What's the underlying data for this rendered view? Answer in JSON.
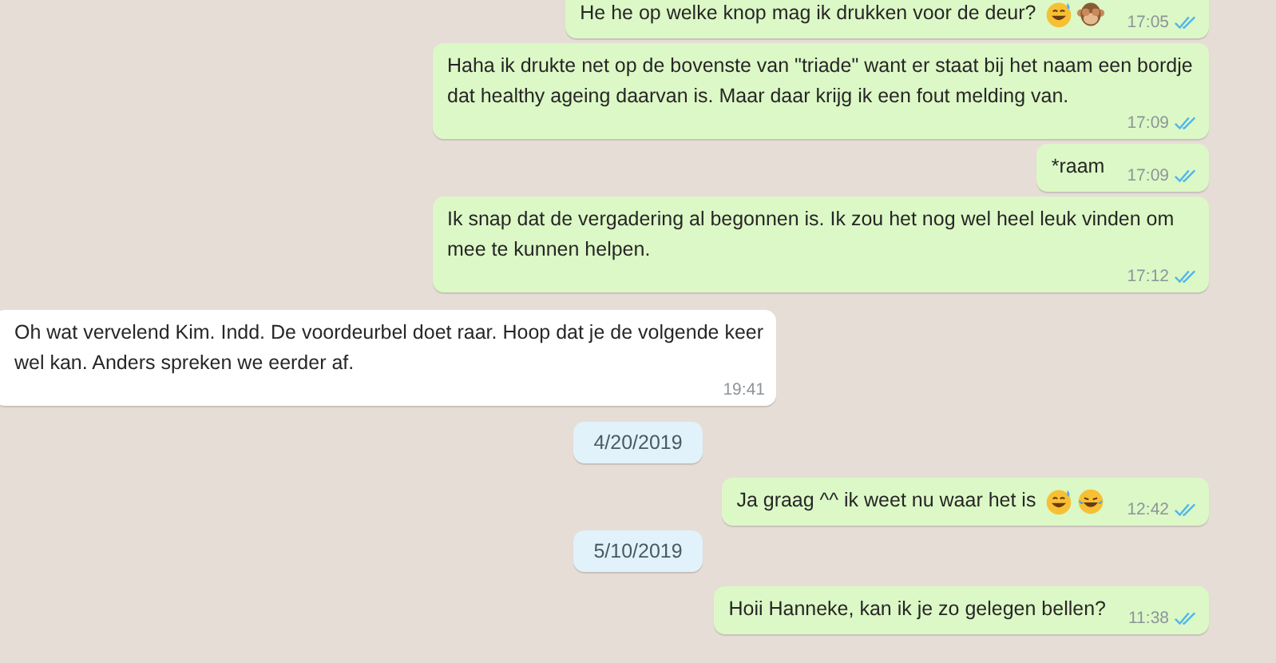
{
  "messages": [
    {
      "kind": "out",
      "text": "He he  op welke knop mag ik drukken voor de deur?",
      "emojis": [
        {
          "kind": "sweat-smile"
        },
        {
          "kind": "see-no-evil"
        }
      ],
      "time": "17:05",
      "read": true
    },
    {
      "kind": "out",
      "text": "Haha ik drukte net op de bovenste van \"triade\"  want er staat bij het naam een bordje dat healthy ageing daarvan is. Maar daar krijg ik een fout melding van.",
      "time": "17:09",
      "read": true
    },
    {
      "kind": "out",
      "text": "*raam",
      "time": "17:09",
      "read": true
    },
    {
      "kind": "out",
      "text": "Ik snap dat de vergadering al begonnen is. Ik zou het nog wel heel leuk vinden om mee te kunnen helpen.",
      "time": "17:12",
      "read": true
    },
    {
      "kind": "in",
      "text": "Oh wat vervelend Kim. Indd. De voordeurbel doet raar. Hoop dat je de volgende keer wel kan. Anders spreken we eerder af.",
      "time": "19:41"
    },
    {
      "kind": "date",
      "text": "4/20/2019"
    },
    {
      "kind": "out",
      "text": "Ja graag ^^ ik weet nu waar het is",
      "emojis": [
        {
          "kind": "sweat-smile"
        },
        {
          "kind": "joy"
        }
      ],
      "time": "12:42",
      "read": true
    },
    {
      "kind": "date",
      "text": "5/10/2019"
    },
    {
      "kind": "out",
      "text": "Hoii Hanneke, kan ik je zo gelegen bellen?",
      "time": "11:38",
      "read": true
    }
  ]
}
